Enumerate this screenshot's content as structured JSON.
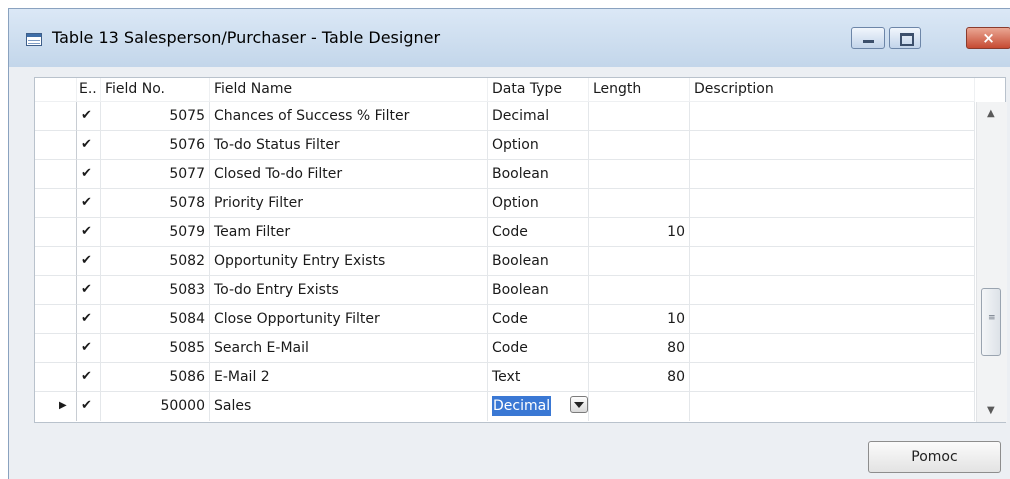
{
  "window": {
    "title": "Table 13 Salesperson/Purchaser - Table Designer",
    "icon": "table-icon",
    "controls": {
      "minimize": "minimize-icon",
      "maximize": "maximize-icon",
      "close": "×"
    }
  },
  "grid": {
    "columns": {
      "enabled": "E..",
      "field_no": "Field No.",
      "field_name": "Field Name",
      "data_type": "Data Type",
      "length": "Length",
      "description": "Description"
    },
    "rows": [
      {
        "check": "✔",
        "no": "5075",
        "name": "Chances of Success % Filter",
        "type": "Decimal",
        "length": "",
        "description": ""
      },
      {
        "check": "✔",
        "no": "5076",
        "name": "To-do Status Filter",
        "type": "Option",
        "length": "",
        "description": ""
      },
      {
        "check": "✔",
        "no": "5077",
        "name": "Closed To-do Filter",
        "type": "Boolean",
        "length": "",
        "description": ""
      },
      {
        "check": "✔",
        "no": "5078",
        "name": "Priority Filter",
        "type": "Option",
        "length": "",
        "description": ""
      },
      {
        "check": "✔",
        "no": "5079",
        "name": "Team Filter",
        "type": "Code",
        "length": "10",
        "description": ""
      },
      {
        "check": "✔",
        "no": "5082",
        "name": "Opportunity Entry Exists",
        "type": "Boolean",
        "length": "",
        "description": ""
      },
      {
        "check": "✔",
        "no": "5083",
        "name": "To-do Entry Exists",
        "type": "Boolean",
        "length": "",
        "description": ""
      },
      {
        "check": "✔",
        "no": "5084",
        "name": "Close Opportunity Filter",
        "type": "Code",
        "length": "10",
        "description": ""
      },
      {
        "check": "✔",
        "no": "5085",
        "name": "Search E-Mail",
        "type": "Code",
        "length": "80",
        "description": ""
      },
      {
        "check": "✔",
        "no": "5086",
        "name": "E-Mail 2",
        "type": "Text",
        "length": "80",
        "description": ""
      }
    ],
    "current_row": {
      "arrow": "▶",
      "check": "✔",
      "no": "50000",
      "name": "Sales",
      "type": "Decimal",
      "length": "",
      "description": ""
    }
  },
  "scrollbar": {
    "up": "▲",
    "down": "▼",
    "grip": "≡"
  },
  "buttons": {
    "help": "Pomoc"
  },
  "colors": {
    "selection": "#3a78d4",
    "window_frame": "#c9daec"
  }
}
